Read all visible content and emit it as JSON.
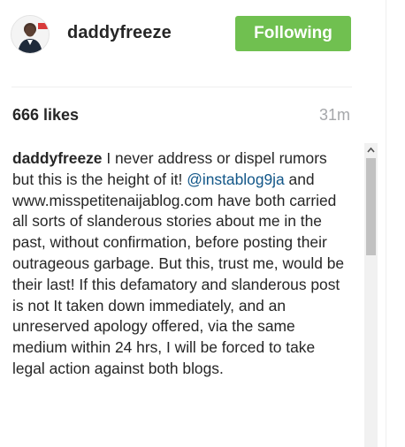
{
  "header": {
    "username": "daddyfreeze",
    "follow_label": "Following"
  },
  "stats": {
    "likes": "666 likes",
    "time_ago": "31m"
  },
  "caption": {
    "author": "daddyfreeze",
    "text_1": " I never address or dispel rumors but this is the height of it! ",
    "mention": "@instablog9ja",
    "text_2": " and www.misspetitenaijablog.com have both carried all sorts of slanderous stories about me in the past, without confirmation, before posting their outrageous garbage. But this, trust me, would be their last! If this defamatory and slanderous post is not It taken down immediately, and an unreserved apology offered, via the same medium within 24 hrs, I will be forced to take legal action against both blogs."
  },
  "icons": {
    "avatar": "user-avatar",
    "scroll_up": "chevron-up-icon"
  },
  "colors": {
    "follow_button": "#70c050",
    "mention_link": "#125688",
    "text": "#262626",
    "muted": "#a5a7aa"
  }
}
